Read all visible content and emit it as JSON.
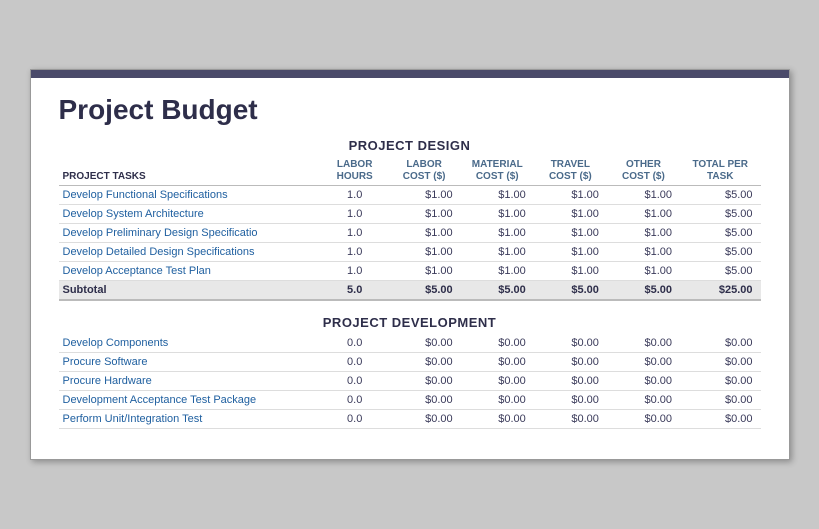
{
  "title": "Project Budget",
  "sections": [
    {
      "id": "design",
      "title": "PROJECT DESIGN",
      "headers": {
        "task": "PROJECT TASKS",
        "labor_hours": "LABOR HOURS",
        "labor_cost": "LABOR COST ($)",
        "material_cost": "MATERIAL COST ($)",
        "travel_cost": "TRAVEL COST ($)",
        "other_cost": "OTHER COST ($)",
        "total": "TOTAL PER TASK"
      },
      "rows": [
        {
          "task": "Develop Functional Specifications",
          "hours": "1.0",
          "labor": "$1.00",
          "material": "$1.00",
          "travel": "$1.00",
          "other": "$1.00",
          "total": "$5.00"
        },
        {
          "task": "Develop System Architecture",
          "hours": "1.0",
          "labor": "$1.00",
          "material": "$1.00",
          "travel": "$1.00",
          "other": "$1.00",
          "total": "$5.00"
        },
        {
          "task": "Develop Preliminary Design Specificatio",
          "hours": "1.0",
          "labor": "$1.00",
          "material": "$1.00",
          "travel": "$1.00",
          "other": "$1.00",
          "total": "$5.00"
        },
        {
          "task": "Develop Detailed Design Specifications",
          "hours": "1.0",
          "labor": "$1.00",
          "material": "$1.00",
          "travel": "$1.00",
          "other": "$1.00",
          "total": "$5.00"
        },
        {
          "task": "Develop Acceptance Test Plan",
          "hours": "1.0",
          "labor": "$1.00",
          "material": "$1.00",
          "travel": "$1.00",
          "other": "$1.00",
          "total": "$5.00"
        }
      ],
      "subtotal": {
        "label": "Subtotal",
        "hours": "5.0",
        "labor": "$5.00",
        "material": "$5.00",
        "travel": "$5.00",
        "other": "$5.00",
        "total": "$25.00"
      }
    },
    {
      "id": "development",
      "title": "PROJECT DEVELOPMENT",
      "rows": [
        {
          "task": "Develop Components",
          "hours": "0.0",
          "labor": "$0.00",
          "material": "$0.00",
          "travel": "$0.00",
          "other": "$0.00",
          "total": "$0.00"
        },
        {
          "task": "Procure Software",
          "hours": "0.0",
          "labor": "$0.00",
          "material": "$0.00",
          "travel": "$0.00",
          "other": "$0.00",
          "total": "$0.00"
        },
        {
          "task": "Procure Hardware",
          "hours": "0.0",
          "labor": "$0.00",
          "material": "$0.00",
          "travel": "$0.00",
          "other": "$0.00",
          "total": "$0.00"
        },
        {
          "task": "Development Acceptance Test Package",
          "hours": "0.0",
          "labor": "$0.00",
          "material": "$0.00",
          "travel": "$0.00",
          "other": "$0.00",
          "total": "$0.00"
        },
        {
          "task": "Perform Unit/Integration Test",
          "hours": "0.0",
          "labor": "$0.00",
          "material": "$0.00",
          "travel": "$0.00",
          "other": "$0.00",
          "total": "$0.00"
        }
      ]
    }
  ]
}
